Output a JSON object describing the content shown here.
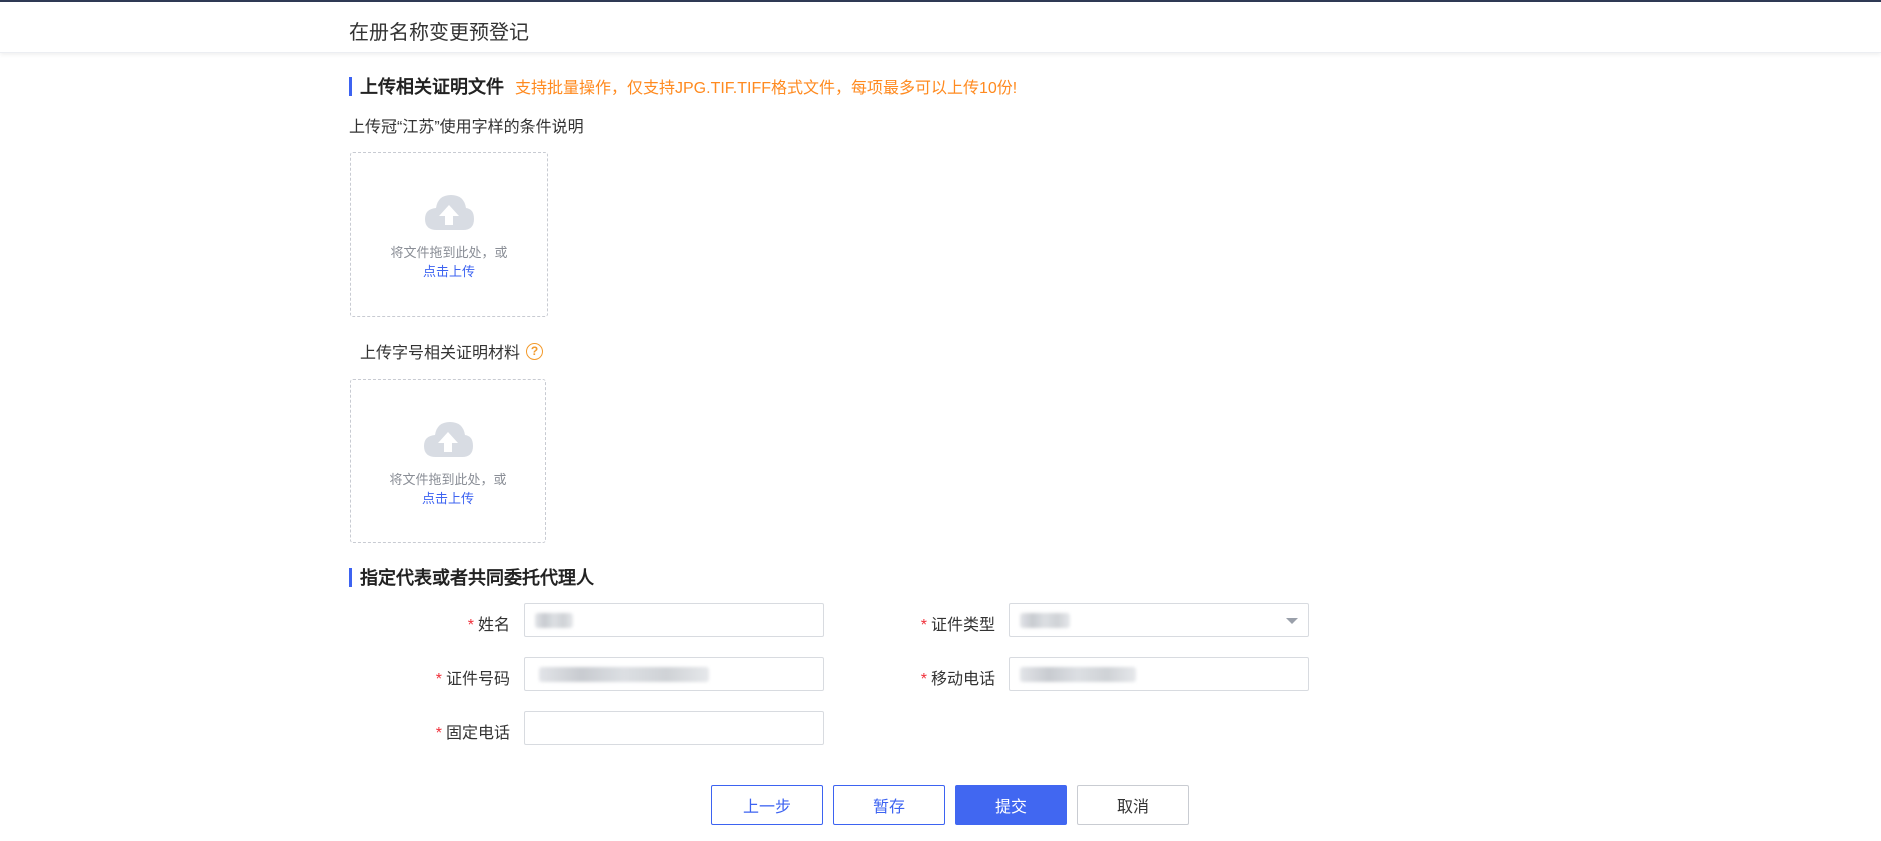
{
  "page": {
    "title": "在册名称变更预登记"
  },
  "upload_section": {
    "title": "上传相关证明文件",
    "note": "支持批量操作，仅支持JPG.TIF.TIFF格式文件，每项最多可以上传10份!",
    "items": [
      {
        "label": "上传冠“江苏”使用字样的条件说明",
        "drop_text": "将文件拖到此处，或",
        "link_text": "点击上传"
      },
      {
        "label": "上传字号相关证明材料",
        "help_glyph": "?",
        "drop_text": "将文件拖到此处，或",
        "link_text": "点击上传"
      }
    ]
  },
  "agent_section": {
    "title": "指定代表或者共同委托代理人",
    "required_mark": "*",
    "fields": {
      "name": {
        "label": "姓名",
        "value": ""
      },
      "id_type": {
        "label": "证件类型",
        "value": ""
      },
      "id_number": {
        "label": "证件号码",
        "value": ""
      },
      "mobile": {
        "label": "移动电话",
        "value": ""
      },
      "landline": {
        "label": "固定电话",
        "value": ""
      }
    }
  },
  "actions": {
    "prev": "上一步",
    "save": "暂存",
    "submit": "提交",
    "cancel": "取消"
  },
  "colors": {
    "accent": "#3d63f1",
    "note": "#ff8a1f",
    "required": "#f0303a"
  },
  "icons": {
    "upload": "cloud-upload-icon",
    "help": "question-circle-icon",
    "dropdown": "chevron-down-icon"
  }
}
